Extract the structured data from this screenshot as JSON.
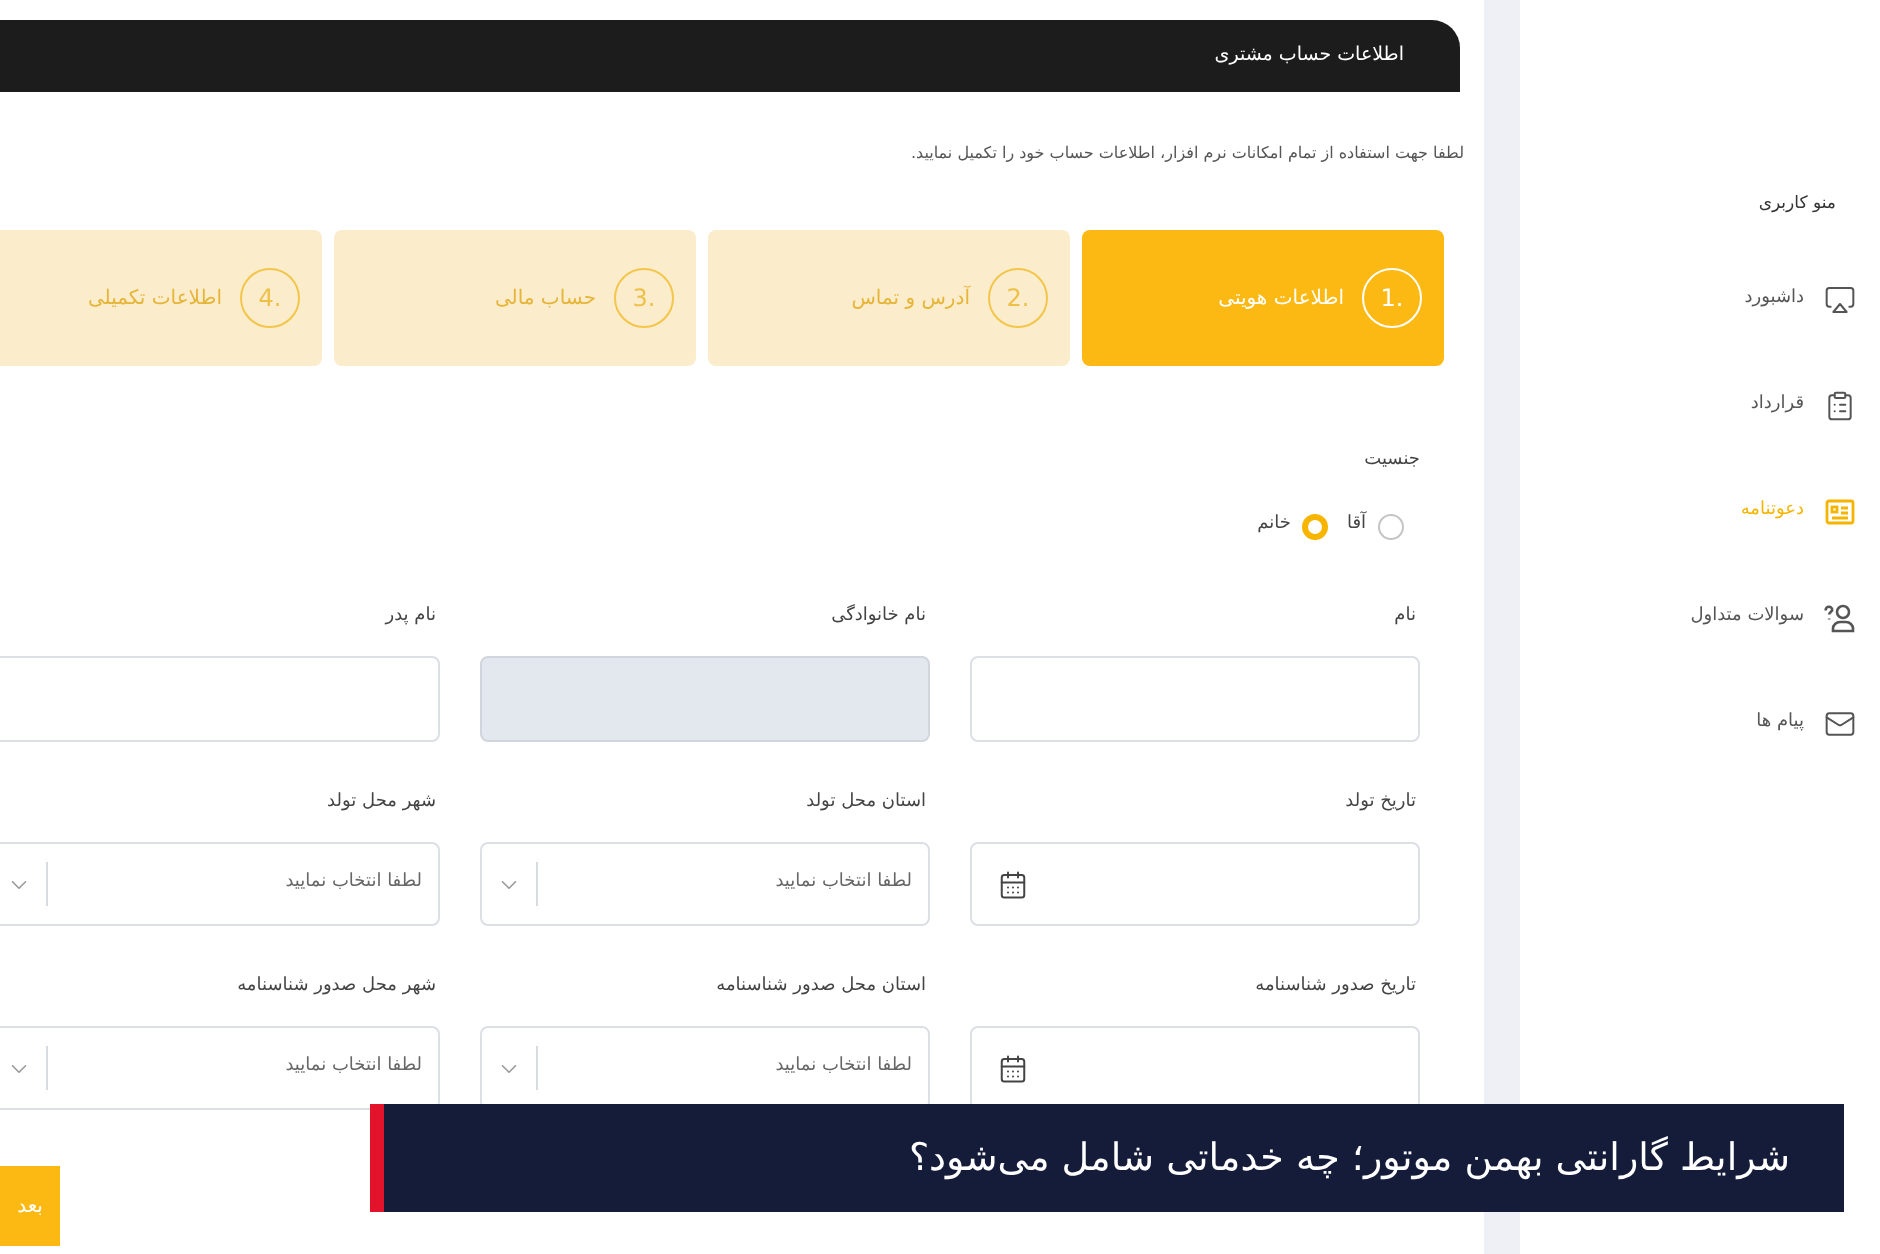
{
  "header": {
    "title": "اطلاعات حساب مشتری"
  },
  "instruction": "لطفا جهت استفاده از تمام امکانات نرم افزار، اطلاعات حساب خود را تکمیل نمایید.",
  "steps": [
    {
      "number": "1.",
      "label": "اطلاعات هویتی",
      "selected": true
    },
    {
      "number": "2.",
      "label": "آدرس و تماس",
      "selected": false
    },
    {
      "number": "3.",
      "label": "حساب مالی",
      "selected": false
    },
    {
      "number": "4.",
      "label": "اطلاعات تکمیلی",
      "selected": false
    }
  ],
  "gender": {
    "label": "جنسیت",
    "options": [
      {
        "label": "آقا",
        "selected": false
      },
      {
        "label": "خانم",
        "selected": true
      }
    ]
  },
  "fields": [
    {
      "kind": "text",
      "label": "نام",
      "disabled": false
    },
    {
      "kind": "text",
      "label": "نام خانوادگی",
      "disabled": true
    },
    {
      "kind": "text",
      "label": "نام پدر",
      "disabled": false
    },
    {
      "kind": "date",
      "label": "تاریخ تولد",
      "disabled": false
    },
    {
      "kind": "select",
      "label": "استان محل تولد",
      "placeholder": "لطفا انتخاب نمایید",
      "disabled": false
    },
    {
      "kind": "select",
      "label": "شهر محل تولد",
      "placeholder": "لطفا انتخاب نمایید",
      "disabled": false
    },
    {
      "kind": "date",
      "label": "تاریخ صدور شناسنامه",
      "disabled": false
    },
    {
      "kind": "select",
      "label": "استان محل صدور شناسنامه",
      "placeholder": "لطفا انتخاب نمایید",
      "disabled": false
    },
    {
      "kind": "select",
      "label": "شهر محل صدور شناسنامه",
      "placeholder": "لطفا انتخاب نمایید",
      "disabled": false
    }
  ],
  "next_button": {
    "label": "بعد"
  },
  "sidebar": {
    "title": "منو کاربری",
    "items": [
      {
        "label": "داشبورد",
        "selected": false
      },
      {
        "label": "قرارداد",
        "selected": false
      },
      {
        "label": "دعوتنامه",
        "selected": true
      },
      {
        "label": "سوالات متداول",
        "selected": false
      },
      {
        "label": "پیام ها",
        "selected": false
      }
    ]
  },
  "caption_banner": {
    "text": "شرایط گارانتی بهمن موتور؛ چه خدماتی شامل می‌شود؟"
  }
}
